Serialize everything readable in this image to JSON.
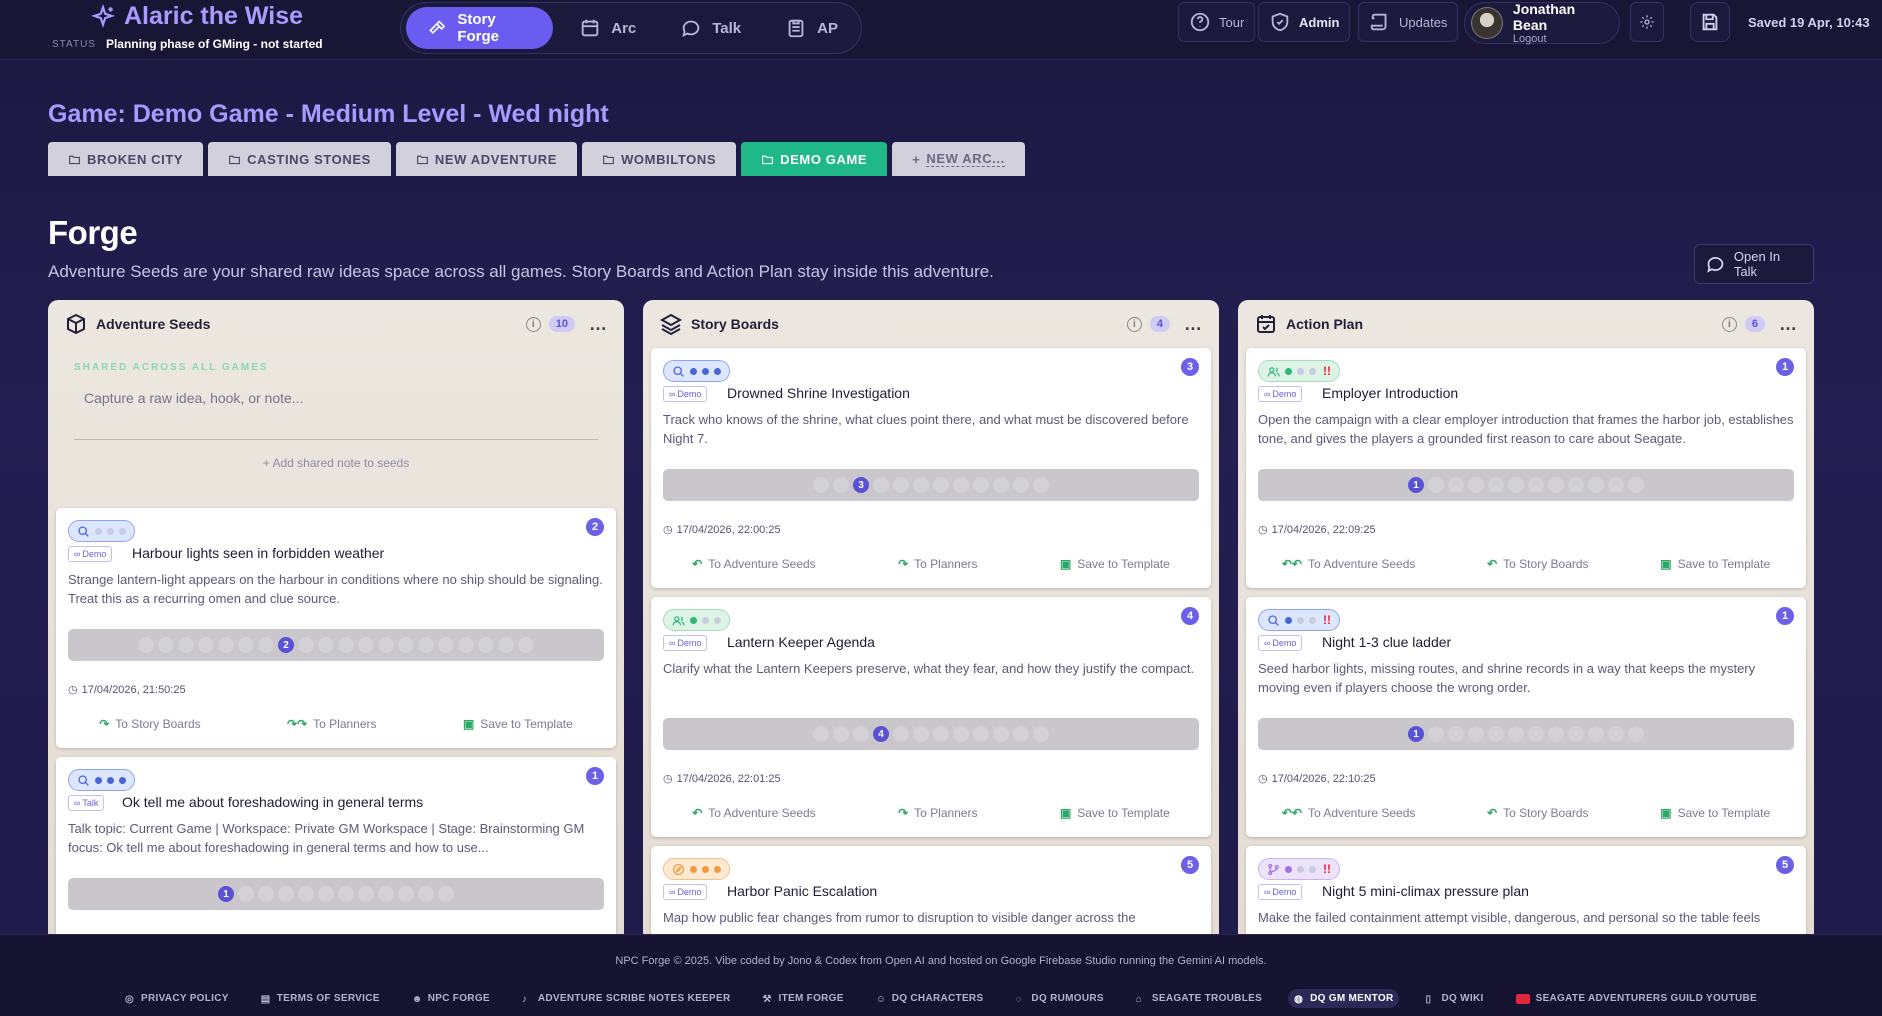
{
  "app": {
    "title": "Alaric the Wise",
    "status_label": "STATUS",
    "status_value": "Planning phase of GMing - not started"
  },
  "mainnav": [
    {
      "label": "Story Forge",
      "icon": "hammer-icon"
    },
    {
      "label": "Arc",
      "icon": "calendar-icon"
    },
    {
      "label": "Talk",
      "icon": "chat-icon"
    },
    {
      "label": "AP",
      "icon": "clipboard-icon"
    }
  ],
  "toolbar": {
    "tour": "Tour",
    "admin": "Admin",
    "updates": "Updates",
    "user_name": "Jonathan Bean",
    "logout": "Logout",
    "saved": "Saved 19 Apr, 10:43"
  },
  "game": {
    "title": "Game: Demo Game - Medium Level - Wed night",
    "tabs": [
      "BROKEN CITY",
      "CASTING STONES",
      "NEW ADVENTURE",
      "WOMBILTONS",
      "DEMO GAME",
      "NEW ARC..."
    ]
  },
  "forge": {
    "heading": "Forge",
    "desc": "Adventure Seeds are your shared raw ideas space across all games. Story Boards and Action Plan stay inside this adventure.",
    "open_talk": "Open In Talk"
  },
  "columns": {
    "seeds": {
      "title": "Adventure Seeds",
      "count": "10",
      "shared": "SHARED ACROSS ALL GAMES",
      "placeholder": "Capture a raw idea, hook, or note...",
      "add": "Add shared note to seeds",
      "cards": [
        {
          "num": "2",
          "tag": "Demo",
          "title": "Harbour lights seen in forbidden weather",
          "desc": "Strange lantern-light appears on the harbour in conditions where no ship should be signaling. Treat this as a recurring omen and clue source.",
          "stage": "2",
          "date": "17/04/2026, 21:50:25",
          "a1": "To Story Boards",
          "a2": "To Planners",
          "a3": "Save to Template"
        },
        {
          "num": "1",
          "tag": "Talk",
          "title": "Ok tell me about foreshadowing in general terms",
          "desc": "Talk topic: Current Game | Workspace: Private GM Workspace | Stage: Brainstorming GM focus: Ok tell me about foreshadowing in general terms and how to use...",
          "stage": "1"
        }
      ]
    },
    "boards": {
      "title": "Story Boards",
      "count": "4",
      "cards": [
        {
          "num": "3",
          "tag": "Demo",
          "title": "Drowned Shrine Investigation",
          "desc": "Track who knows of the shrine, what clues point there, and what must be discovered before Night 7.",
          "stage": "3",
          "date": "17/04/2026, 22:00:25",
          "a1": "To Adventure Seeds",
          "a2": "To Planners",
          "a3": "Save to Template"
        },
        {
          "num": "4",
          "tag": "Demo",
          "title": "Lantern Keeper Agenda",
          "desc": "Clarify what the Lantern Keepers preserve, what they fear, and how they justify the compact.",
          "stage": "4",
          "date": "17/04/2026, 22:01:25",
          "a1": "To Adventure Seeds",
          "a2": "To Planners",
          "a3": "Save to Template"
        },
        {
          "num": "5",
          "tag": "Demo",
          "title": "Harbor Panic Escalation",
          "desc": "Map how public fear changes from rumor to disruption to visible danger across the"
        }
      ]
    },
    "plan": {
      "title": "Action Plan",
      "count": "6",
      "cards": [
        {
          "num": "1",
          "tag": "Demo",
          "title": "Employer Introduction",
          "desc": "Open the campaign with a clear employer introduction that frames the harbor job, establishes tone, and gives the players a grounded first reason to care about Seagate.",
          "stage": "1",
          "date": "17/04/2026, 22:09:25",
          "a1": "To Adventure Seeds",
          "a2": "To Story Boards",
          "a3": "Save to Template"
        },
        {
          "num": "1",
          "tag": "Demo",
          "title": "Night 1-3 clue ladder",
          "desc": "Seed harbor lights, missing routes, and shrine records in a way that keeps the mystery moving even if players choose the wrong order.",
          "stage": "1",
          "date": "17/04/2026, 22:10:25",
          "a1": "To Adventure Seeds",
          "a2": "To Story Boards",
          "a3": "Save to Template"
        },
        {
          "num": "5",
          "tag": "Demo",
          "title": "Night 5 mini-climax pressure plan",
          "desc": "Make the failed containment attempt visible, dangerous, and personal so the table feels"
        }
      ]
    }
  },
  "footer": {
    "copy": "NPC Forge © 2025. Vibe coded by Jono & Codex from Open AI and hosted on Google Firebase Studio running the Gemini AI models.",
    "links": [
      "PRIVACY POLICY",
      "TERMS OF SERVICE",
      "NPC FORGE",
      "ADVENTURE SCRIBE NOTES KEEPER",
      "ITEM FORGE",
      "DQ CHARACTERS",
      "DQ RUMOURS",
      "SEAGATE TROUBLES",
      "DQ GM MENTOR",
      "DQ WIKI",
      "SEAGATE ADVENTURERS GUILD YOUTUBE"
    ]
  },
  "colors": {
    "accent": "#6a5cf0",
    "active_tab": "#1fb887",
    "title": "#a79bff"
  }
}
